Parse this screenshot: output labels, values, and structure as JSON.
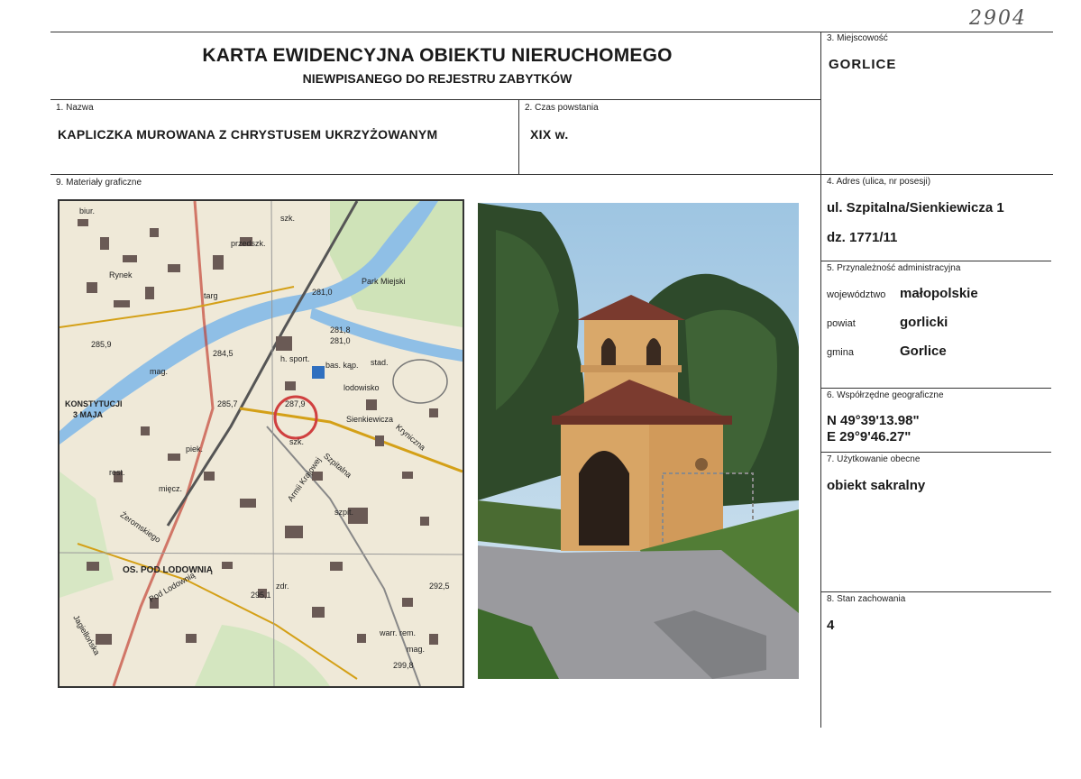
{
  "sheet_number": "2904",
  "header": {
    "title": "KARTA EWIDENCYJNA OBIEKTU NIERUCHOMEGO",
    "subtitle": "NIEWPISANEGO DO REJESTRU ZABYTKÓW"
  },
  "fields": {
    "nazwa": {
      "label": "1. Nazwa",
      "value": "KAPLICZKA MUROWANA Z CHRYSTUSEM UKRZYŻOWANYM"
    },
    "czas_powstania": {
      "label": "2. Czas powstania",
      "value": "XIX w."
    },
    "miejscowosc": {
      "label": "3. Miejscowość",
      "value": "GORLICE"
    },
    "adres": {
      "label": "4. Adres (ulica, nr posesji)",
      "line1": "ul. Szpitalna/Sienkiewicza 1",
      "line2": "dz. 1771/11"
    },
    "przynaleznosc": {
      "label": "5. Przynależność administracyjna",
      "wojewodztwo_label": "województwo",
      "wojewodztwo": "małopolskie",
      "powiat_label": "powiat",
      "powiat": "gorlicki",
      "gmina_label": "gmina",
      "gmina": "Gorlice"
    },
    "wspolrzedne": {
      "label": "6. Współrzędne geograficzne",
      "lat": "N 49°39'13.98\"",
      "lon": "E 29°9'46.27\""
    },
    "uzytkowanie": {
      "label": "7. Użytkowanie obecne",
      "value": "obiekt sakralny"
    },
    "stan": {
      "label": "8. Stan zachowania",
      "value": "4"
    },
    "materialy": {
      "label": "9. Materiały graficzne"
    }
  },
  "map": {
    "labels": [
      "biur.",
      "szk.",
      "przedszk.",
      "Rynek",
      "targ",
      "Park Miejski",
      "281,0",
      "h. sport.",
      "281,8",
      "281,0",
      "285,9",
      "284,5",
      "mag.",
      "bas. kąp.",
      "stad.",
      "lodowisko",
      "KONSTYTUCJI",
      "3 MAJA",
      "285,7",
      "287,9",
      "Sienkiewicza",
      "piek.",
      "szk.",
      "Armii Krajowej",
      "Szpitalna",
      "Kryniczna",
      "rest.",
      "mięcz.",
      "Żeromskiego",
      "szpit.",
      "OS. POD LODOWNIĄ",
      "295,1",
      "Pod Lodownią",
      "zdr.",
      "292,5",
      "warr. rem.",
      "mag.",
      "299,8",
      "Jagiellońska"
    ]
  },
  "colors": {
    "line": "#333333",
    "map_bg": "#efe9d8",
    "river": "#6fa8dc",
    "marker": "#d04040"
  }
}
